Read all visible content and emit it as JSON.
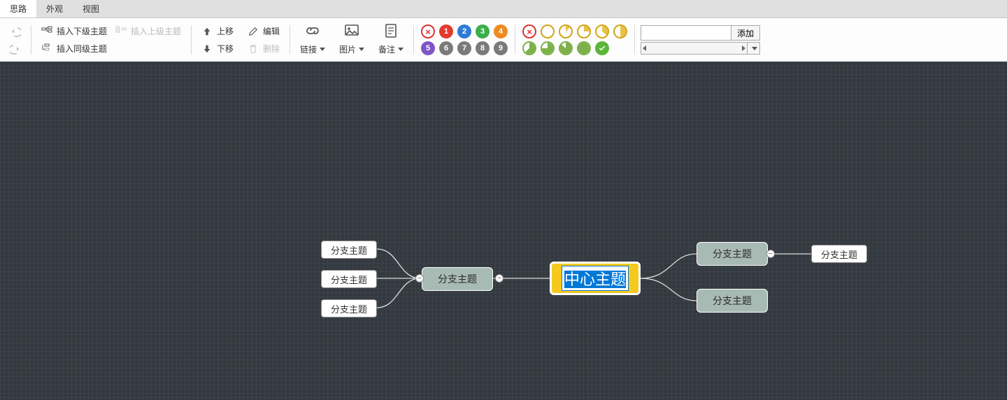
{
  "menu": {
    "items": [
      "思路",
      "外观",
      "视图"
    ],
    "active_index": 0
  },
  "toolbar": {
    "undo": "",
    "redo": "",
    "insert_child": "插入下级主题",
    "insert_parent": "插入上级主题",
    "insert_sibling": "插入同级主题",
    "move_up": "上移",
    "move_down": "下移",
    "edit": "编辑",
    "delete": "删除",
    "link": "链接",
    "image": "图片",
    "note": "备注"
  },
  "priorities": {
    "clear": "×",
    "row1": [
      {
        "n": "1",
        "bg": "#e23b2e"
      },
      {
        "n": "2",
        "bg": "#2e7bd6"
      },
      {
        "n": "3",
        "bg": "#3aae4a"
      },
      {
        "n": "4",
        "bg": "#ee8a1f"
      }
    ],
    "row2": [
      {
        "n": "5",
        "bg": "#7e55c7"
      },
      {
        "n": "6",
        "bg": "#7a7a7a"
      },
      {
        "n": "7",
        "bg": "#7a7a7a"
      },
      {
        "n": "8",
        "bg": "#7a7a7a"
      },
      {
        "n": "9",
        "bg": "#7a7a7a"
      }
    ]
  },
  "progress": {
    "clear": "×",
    "row1_fracs": [
      0,
      0.125,
      0.25,
      0.375,
      0.5
    ],
    "row2_fracs": [
      0.625,
      0.75,
      0.875,
      1.0
    ]
  },
  "resource": {
    "input_value": "",
    "add_label": "添加"
  },
  "mindmap": {
    "center": "中心主题",
    "main_left": "分支主题",
    "main_right_1": "分支主题",
    "main_right_2": "分支主题",
    "sub_left_1": "分支主题",
    "sub_left_2": "分支主题",
    "sub_left_3": "分支主题",
    "sub_right": "分支主题"
  }
}
